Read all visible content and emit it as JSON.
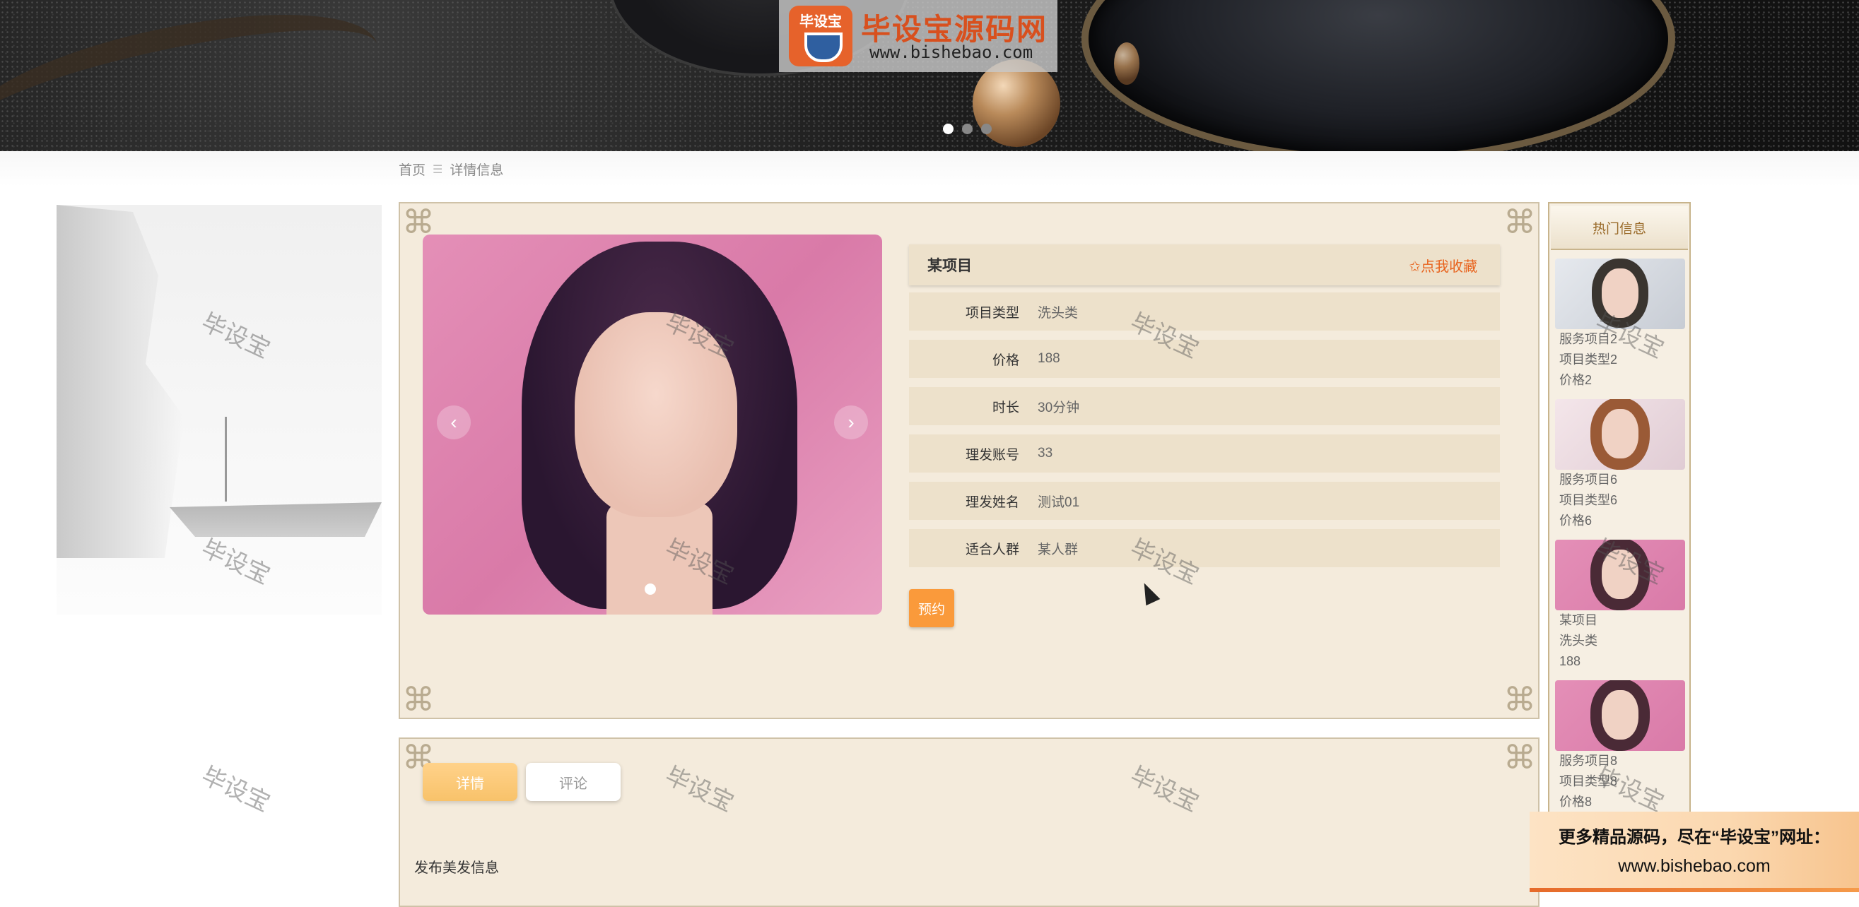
{
  "banner": {
    "logo_icon_text": "毕设宝",
    "logo_title": "毕设宝源码网",
    "logo_url": "www.bishebao.com",
    "slides": 3,
    "active_slide": 1
  },
  "breadcrumb": {
    "home": "首页",
    "separator": "☰",
    "current": "详情信息"
  },
  "watermark_text": "毕设宝",
  "detail": {
    "name": "某项目",
    "favorite_label": "✩点我收藏",
    "fields": [
      {
        "label": "项目类型",
        "value": "洗头类"
      },
      {
        "label": "价格",
        "value": "188"
      },
      {
        "label": "时长",
        "value": "30分钟"
      },
      {
        "label": "理发账号",
        "value": "33"
      },
      {
        "label": "理发姓名",
        "value": "测试01"
      },
      {
        "label": "适合人群",
        "value": "某人群"
      }
    ],
    "book_label": "预约",
    "carousel": {
      "prev": "‹",
      "next": "›"
    }
  },
  "tabs": {
    "detail_label": "详情",
    "comment_label": "评论",
    "section_title": "发布美发信息"
  },
  "sidebar": {
    "title": "热门信息",
    "items": [
      {
        "l1": "服务项目2",
        "l2": "项目类型2",
        "l3": "价格2"
      },
      {
        "l1": "服务项目6",
        "l2": "项目类型6",
        "l3": "价格6"
      },
      {
        "l1": "某项目",
        "l2": "洗头类",
        "l3": "188"
      },
      {
        "l1": "服务项目8",
        "l2": "项目类型8",
        "l3": "价格8"
      }
    ]
  },
  "ad": {
    "line1": "更多精品源码，尽在“毕设宝”网址：",
    "line2": "www.bishebao.com"
  },
  "colors": {
    "accent": "#e8621c",
    "button": "#fa9a3b",
    "panel_bg": "#f4ebdc",
    "row_bg": "#ede1cb"
  }
}
